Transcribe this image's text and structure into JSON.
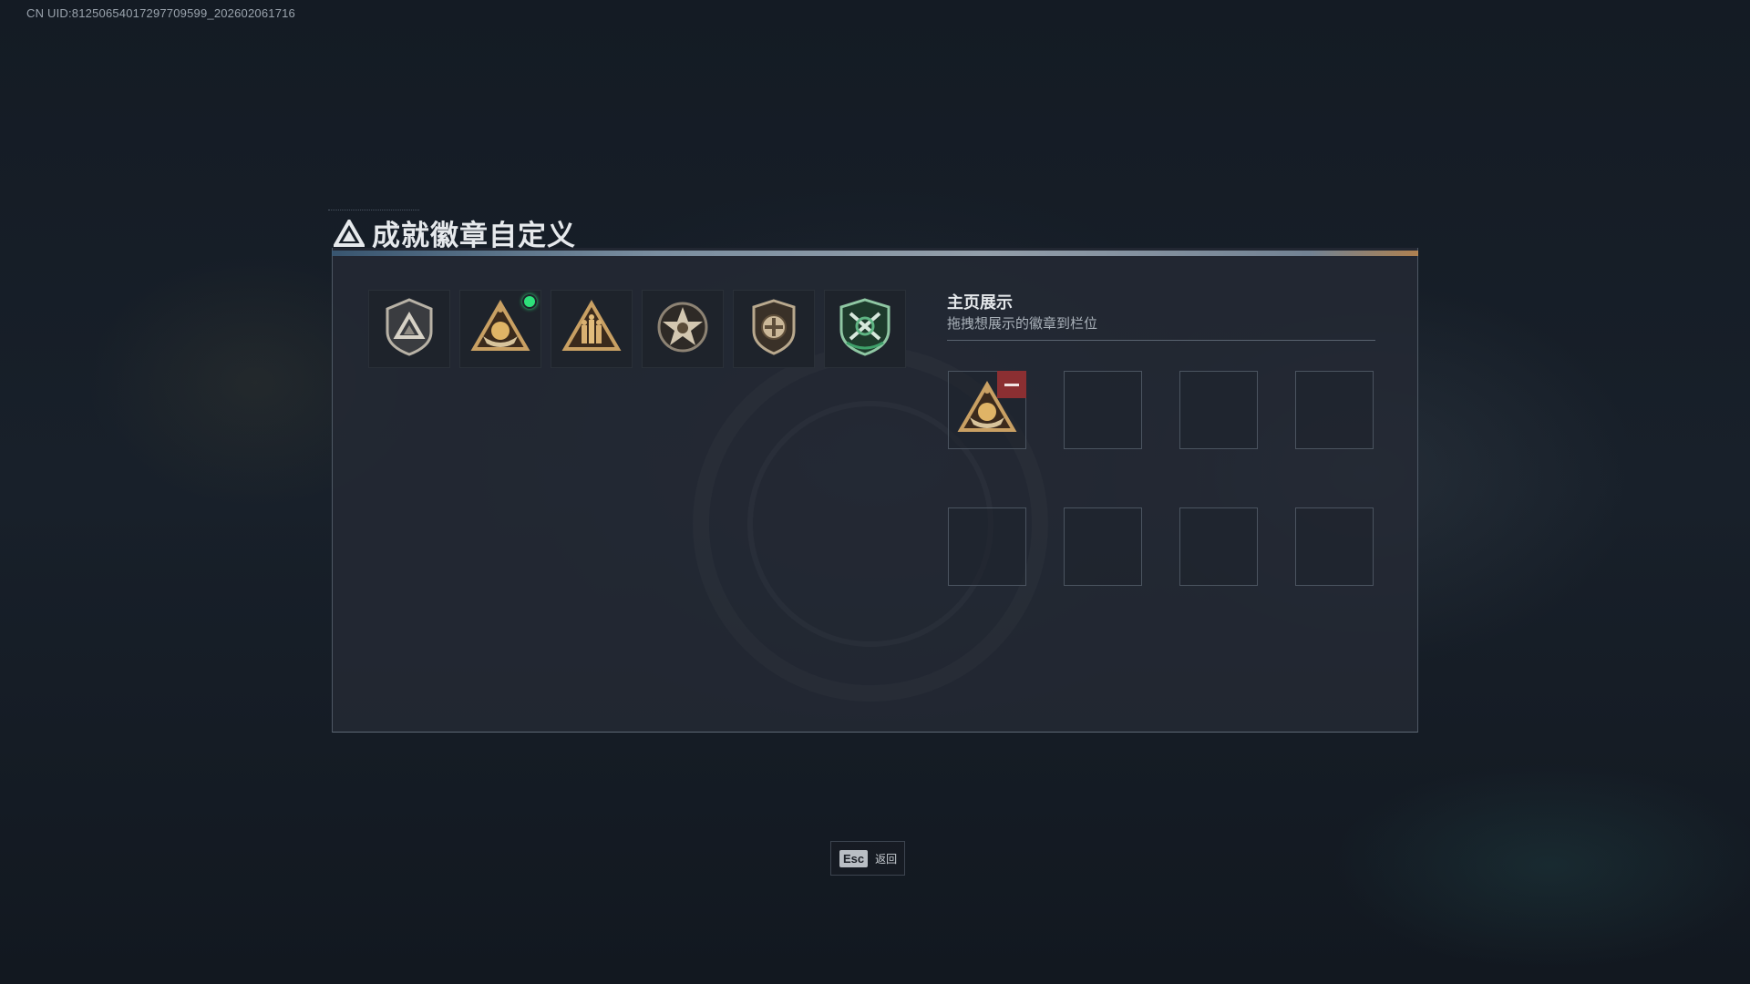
{
  "uid_text": "CN UID:81250654017297709599_202602061716",
  "page_title": "成就徽章自定义",
  "badges": [
    {
      "icon": "shield-triangle-badge-icon",
      "is_new": false
    },
    {
      "icon": "boat-triangle-badge-icon",
      "is_new": true
    },
    {
      "icon": "figures-triangle-badge-icon",
      "is_new": false
    },
    {
      "icon": "star-medal-badge-icon",
      "is_new": false
    },
    {
      "icon": "cross-shield-badge-icon",
      "is_new": false
    },
    {
      "icon": "green-crossed-rifles-badge-icon",
      "is_new": false
    }
  ],
  "showcase": {
    "title": "主页展示",
    "subtitle": "拖拽想展示的徽章到栏位",
    "slots": [
      {
        "badge": "boat-triangle-badge-icon",
        "removable": true
      },
      {
        "badge": null
      },
      {
        "badge": null
      },
      {
        "badge": null
      },
      {
        "badge": null
      },
      {
        "badge": null
      },
      {
        "badge": null
      },
      {
        "badge": null
      }
    ]
  },
  "footer": {
    "esc_key": "Esc",
    "esc_label": "返回"
  },
  "colors": {
    "accent_green": "#2ee07a",
    "remove_red": "#8b2f32",
    "badge_gold": "#c9a063"
  }
}
